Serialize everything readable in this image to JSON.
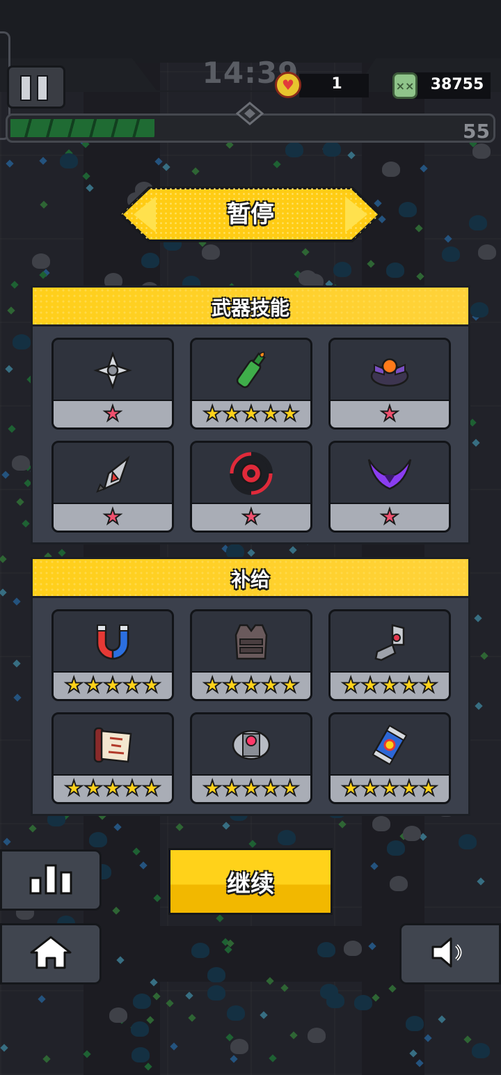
{
  "hud": {
    "timer": "14:39",
    "coins": "1",
    "kills": "38755",
    "level": "55",
    "xp_progress": 0.3
  },
  "pause": {
    "title": "暂停"
  },
  "weapons": {
    "title": "武器技能",
    "items": [
      {
        "icon": "shuriken-icon",
        "stars": 1
      },
      {
        "icon": "molotov-bottle-icon",
        "stars": 5
      },
      {
        "icon": "drone-turret-icon",
        "stars": 1
      },
      {
        "icon": "kunai-icon",
        "stars": 1
      },
      {
        "icon": "red-disc-icon",
        "stars": 1
      },
      {
        "icon": "purple-boomerang-icon",
        "stars": 1
      }
    ]
  },
  "supplies": {
    "title": "补给",
    "items": [
      {
        "icon": "magnet-icon",
        "stars": 5
      },
      {
        "icon": "armor-vest-icon",
        "stars": 5
      },
      {
        "icon": "robot-arm-icon",
        "stars": 5
      },
      {
        "icon": "scroll-icon",
        "stars": 5
      },
      {
        "icon": "energy-core-icon",
        "stars": 5
      },
      {
        "icon": "energy-drink-icon",
        "stars": 5
      }
    ]
  },
  "buttons": {
    "continue_label": "继续"
  },
  "colors": {
    "accent_yellow": "#ffd21a",
    "star_gold": "#ffd21a",
    "star_pink": "#f0506e",
    "panel_bg": "#3b404c"
  }
}
